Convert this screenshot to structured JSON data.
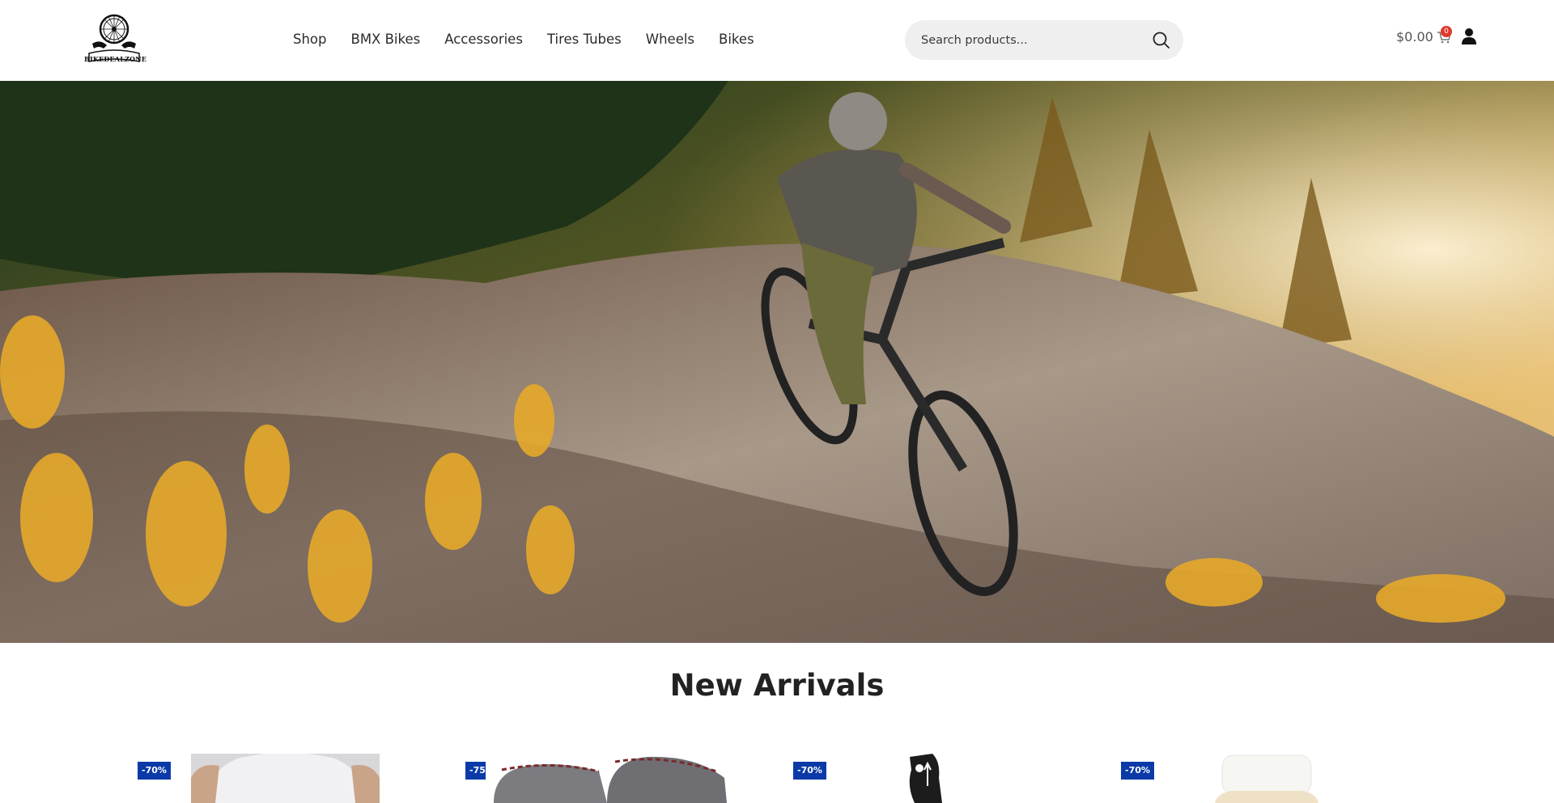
{
  "brand": {
    "logo_text": "BIKEDEALZONE"
  },
  "nav": {
    "items": [
      {
        "label": "Shop"
      },
      {
        "label": "BMX Bikes"
      },
      {
        "label": "Accessories"
      },
      {
        "label": "Tires Tubes"
      },
      {
        "label": "Wheels"
      },
      {
        "label": "Bikes"
      }
    ]
  },
  "search": {
    "placeholder": "Search products..."
  },
  "cart": {
    "total": "$0.00",
    "count": "0"
  },
  "section": {
    "title": "New Arrivals"
  },
  "products": [
    {
      "badge": "-70%"
    },
    {
      "badge": "-75%"
    },
    {
      "badge": "-70%"
    },
    {
      "badge": "-70%"
    }
  ],
  "colors": {
    "badge": "#0b3aa8",
    "cart_count": "#e0392b",
    "search_bg": "#efefef"
  },
  "icons": [
    "search-icon",
    "cart-icon",
    "user-icon"
  ]
}
